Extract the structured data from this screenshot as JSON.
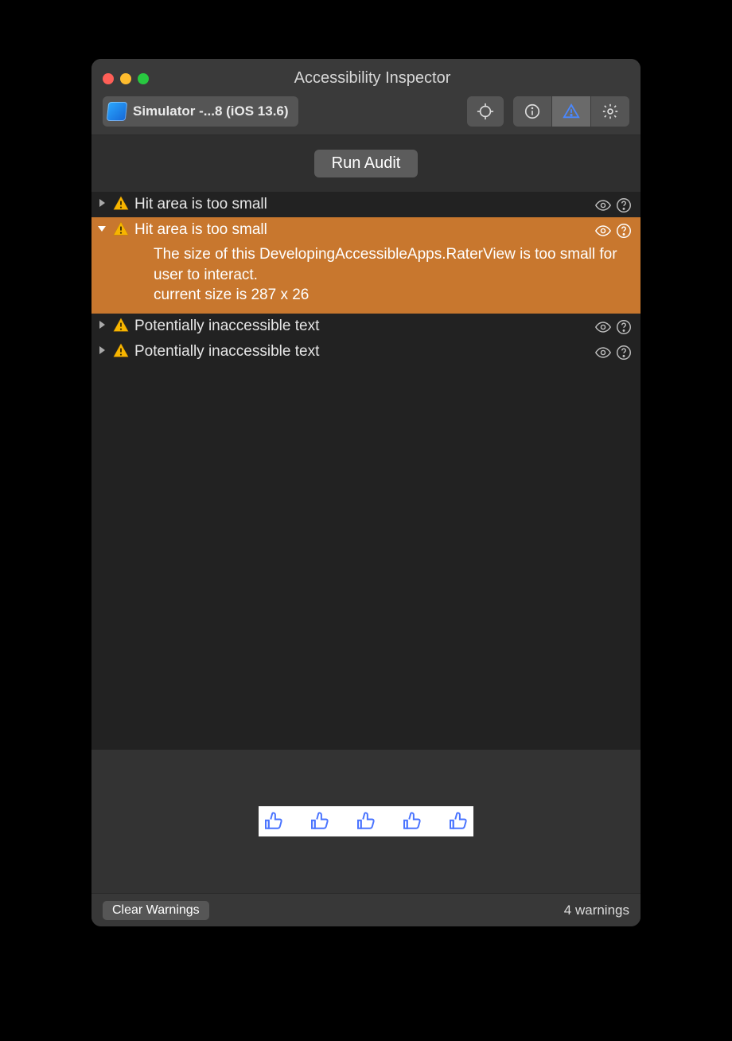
{
  "window": {
    "title": "Accessibility Inspector"
  },
  "toolbar": {
    "target_label": "Simulator -...8 (iOS 13.6)",
    "run_audit_label": "Run Audit"
  },
  "issues": [
    {
      "title": "Hit area is too small",
      "expanded": false,
      "detail": ""
    },
    {
      "title": "Hit area is too small",
      "expanded": true,
      "detail": "The size of this DevelopingAccessibleApps.RaterView is too small for user to interact.\ncurrent size is 287 x 26"
    },
    {
      "title": "Potentially inaccessible text",
      "expanded": false,
      "detail": ""
    },
    {
      "title": "Potentially inaccessible text",
      "expanded": false,
      "detail": ""
    }
  ],
  "preview": {
    "thumb_count": 5
  },
  "footer": {
    "clear_label": "Clear Warnings",
    "warning_count_label": "4 warnings"
  }
}
